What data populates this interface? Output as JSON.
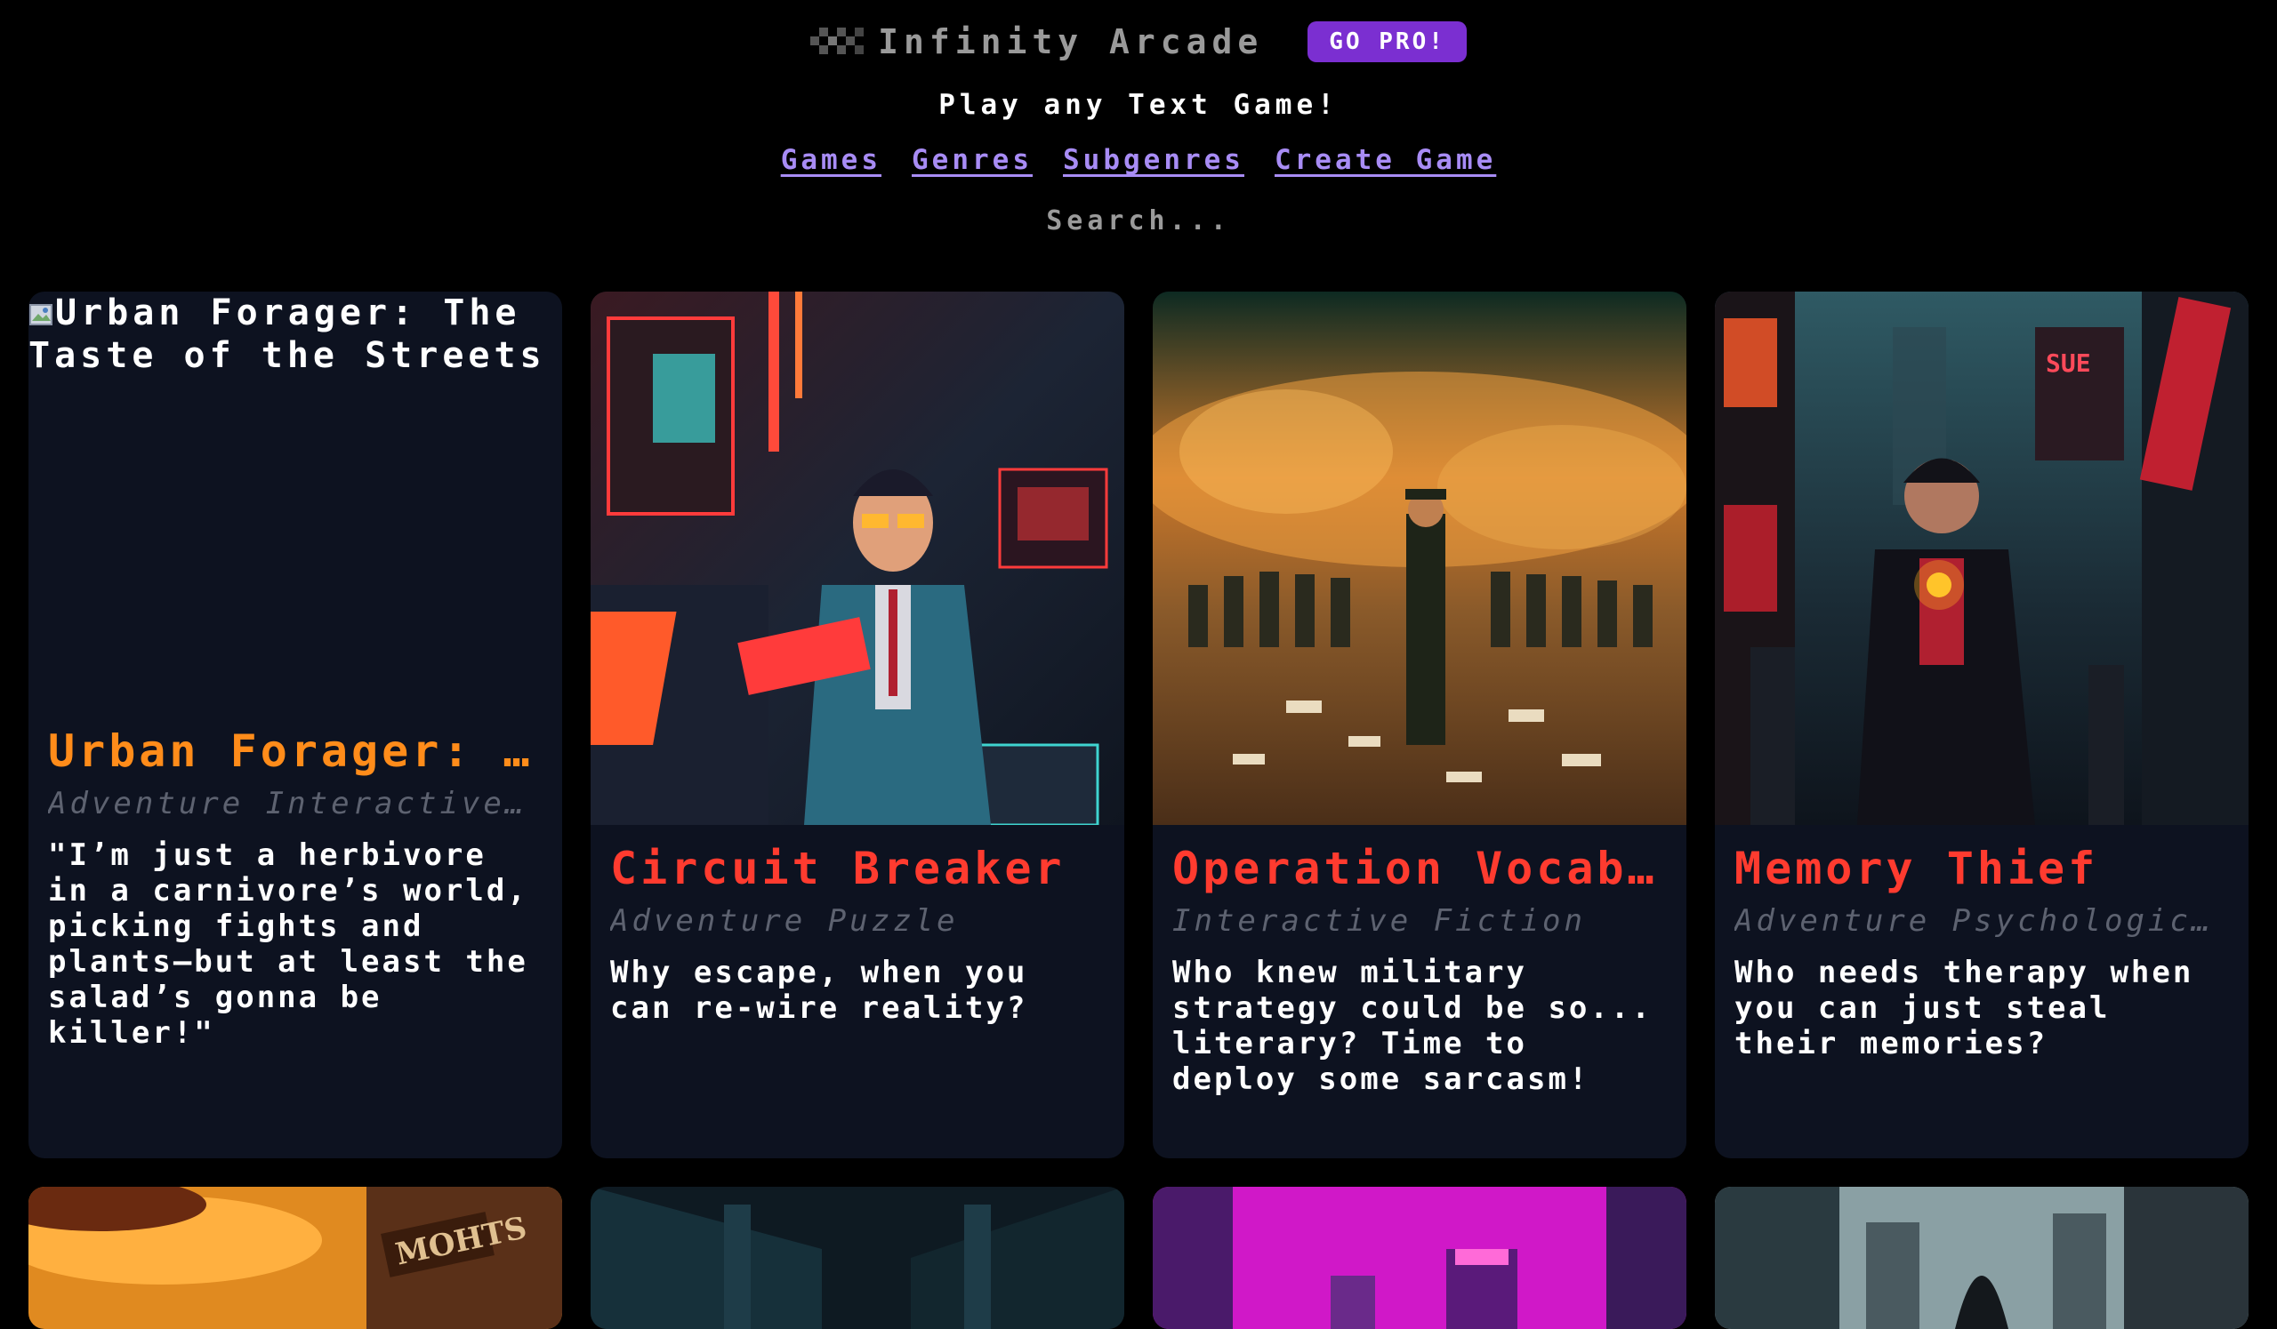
{
  "header": {
    "brand_title": "Infinity Arcade",
    "pro_label": "GO PRO!",
    "tagline": "Play any Text Game!",
    "nav": [
      "Games",
      "Genres",
      "Subgenres",
      "Create Game"
    ],
    "search_placeholder": "Search..."
  },
  "colors": {
    "accent_purple": "#7b2fd1",
    "link": "#a88cf5",
    "title_orange": "#ff8c1a",
    "title_red": "#ff3b2f",
    "card_bg": "#0d1220"
  },
  "cards": [
    {
      "image_alt": "Urban Forager: The Taste of the Streets",
      "title": "Urban Forager: The Taste of the Streets",
      "genres": "Adventure Interactive Fiction",
      "description": "\"I’m just a herbivore in a carnivore’s world, picking fights and plants—but at least the salad’s gonna be killer!\""
    },
    {
      "title": "Circuit Breaker",
      "genres": "Adventure Puzzle",
      "description": "Why escape, when you can re-wire reality?"
    },
    {
      "title": "Operation Vocabulary",
      "genres": "Interactive Fiction",
      "description": "Who knew military strategy could be so... literary? Time to deploy some sarcasm!"
    },
    {
      "title": "Memory Thief",
      "genres": "Adventure Psychological",
      "description": "Who needs therapy when you can just steal their memories?"
    }
  ]
}
